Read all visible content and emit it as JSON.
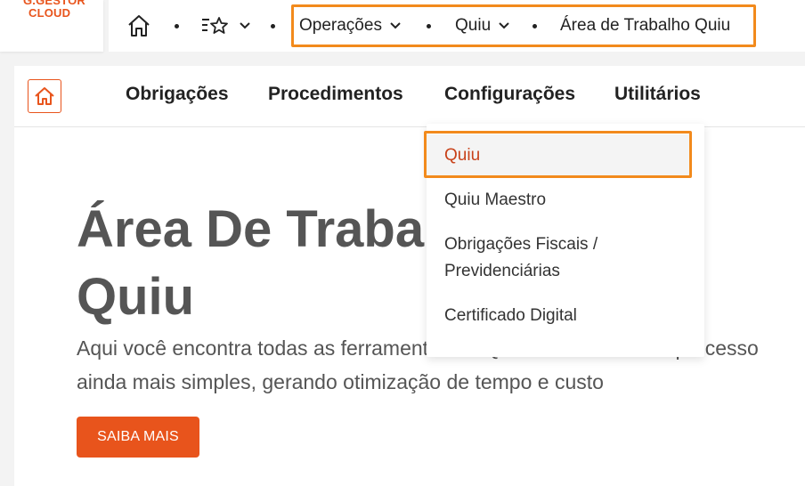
{
  "logo": {
    "line1": "G.GESTOR",
    "line2": "CLOUD"
  },
  "topbar": {
    "home_icon": "home-icon",
    "favorites_icon": "star-list-icon",
    "breadcrumbs": [
      {
        "label": "Operações",
        "has_dropdown": true
      },
      {
        "label": "Quiu",
        "has_dropdown": true
      },
      {
        "label": "Área de Trabalho Quiu",
        "has_dropdown": false
      }
    ]
  },
  "nav": {
    "home_icon": "home-icon",
    "links": [
      "Obrigações",
      "Procedimentos",
      "Configurações",
      "Utilitários"
    ]
  },
  "hero": {
    "title": "Área De Trabalho\nQuiu",
    "text": "Aqui você encontra todas as ferramentas do Quiu tornando o seu processo ainda mais simples, gerando otimização de tempo e custo",
    "cta": "SAIBA MAIS"
  },
  "dropdown": {
    "items": [
      "Quiu",
      "Quiu Maestro",
      "Obrigações Fiscais / Previdenciárias",
      "Certificado Digital"
    ],
    "active_index": 0
  },
  "colors": {
    "accent": "#e8541c",
    "highlight": "#f28a1c",
    "heading": "#555555"
  }
}
